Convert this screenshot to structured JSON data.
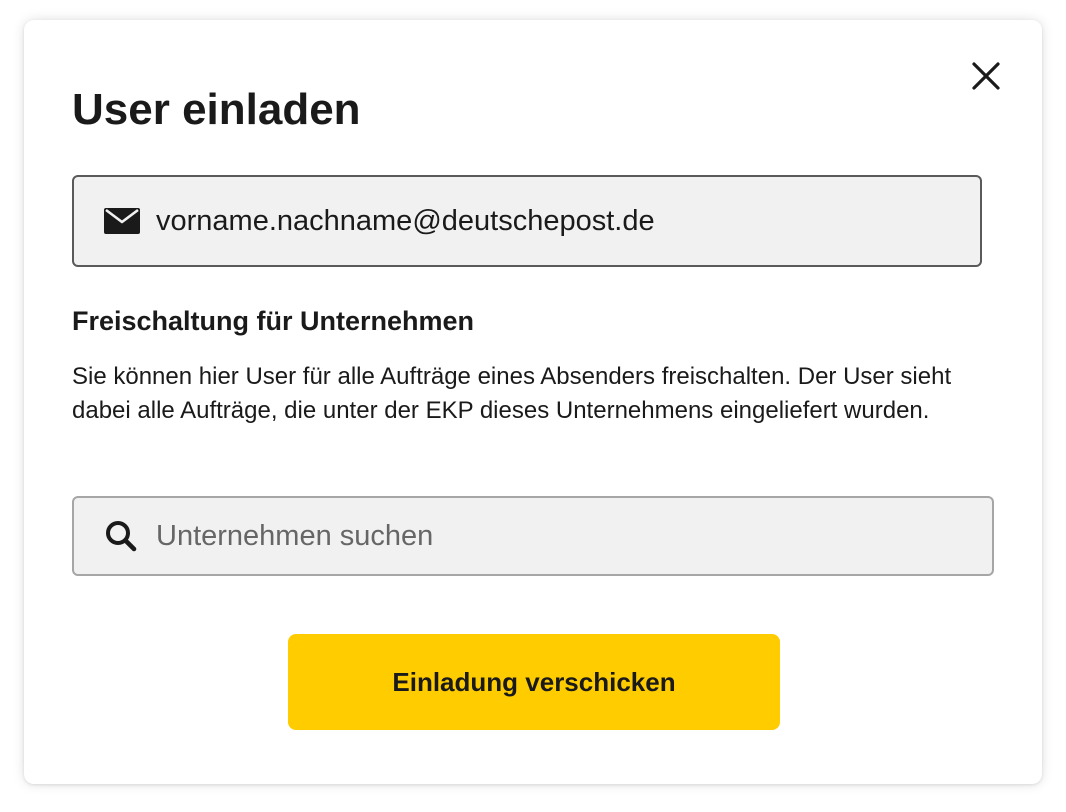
{
  "dialog": {
    "title": "User einladen",
    "close_icon": "close-icon"
  },
  "email": {
    "icon": "mail-icon",
    "value": "vorname.nachname@deutschepost.de"
  },
  "company_section": {
    "title": "Freischaltung für Unternehmen",
    "description": "Sie können hier User für alle Aufträge eines Absenders freischalten. Der User sieht dabei alle Aufträge, die unter der EKP dieses Unternehmens eingeliefert wurden."
  },
  "search": {
    "icon": "search-icon",
    "placeholder": "Unternehmen suchen",
    "value": ""
  },
  "actions": {
    "submit_label": "Einladung verschicken"
  },
  "colors": {
    "accent": "#ffcc00",
    "field_background": "#f1f1f1",
    "text": "#1a1a1a"
  }
}
